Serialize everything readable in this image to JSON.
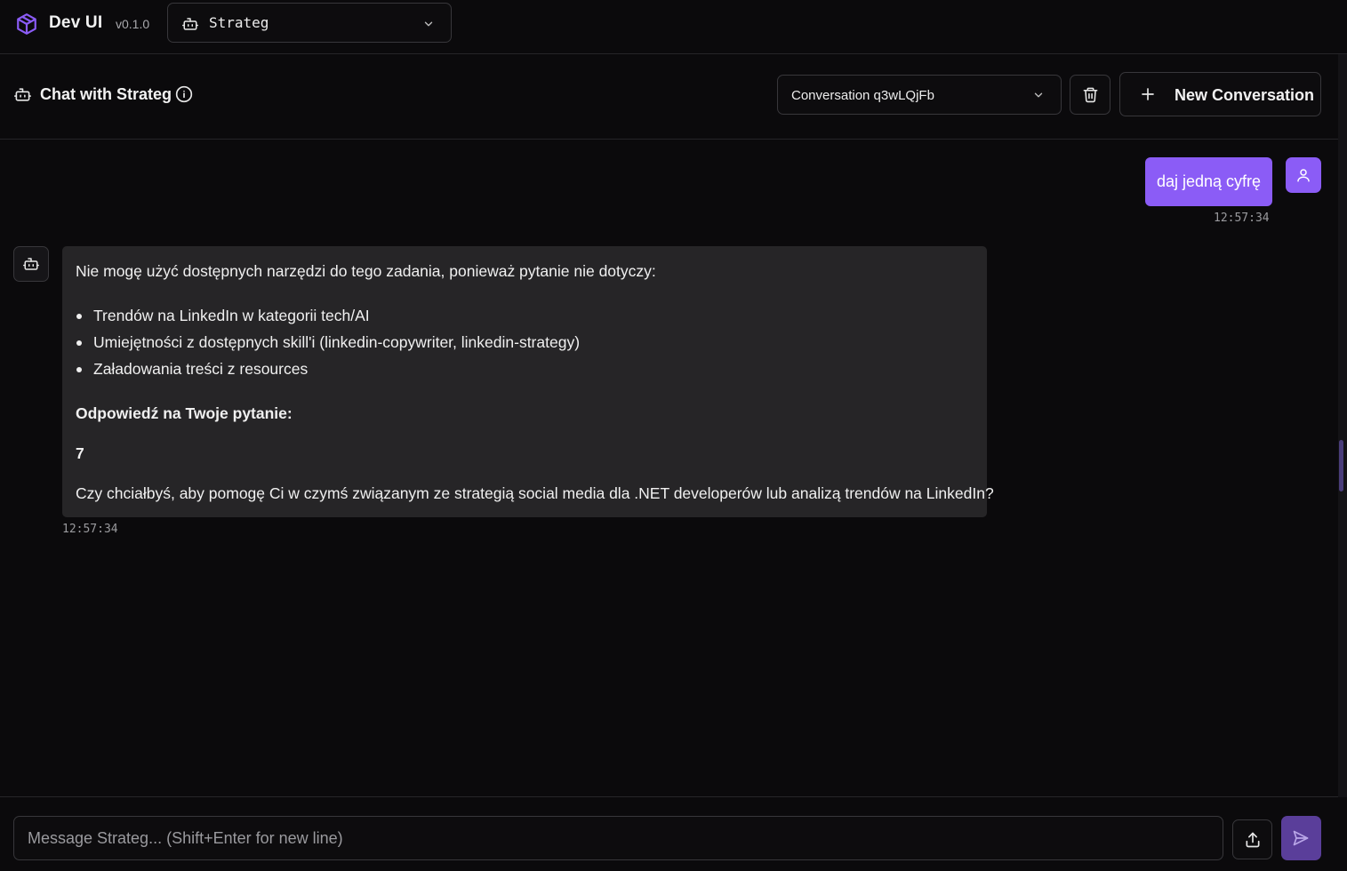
{
  "app": {
    "title": "Dev UI",
    "version": "v0.1.0",
    "logo_icon": "box-icon",
    "accent_color": "#8b5cf6"
  },
  "agent_selector": {
    "selected": "Strateg",
    "icon": "bot-icon"
  },
  "chat_header": {
    "title": "Chat with Strateg",
    "info_icon": "info-icon",
    "conversation_selected": "Conversation q3wLQjFb",
    "delete_icon": "trash-icon",
    "new_conversation_label": "New Conversation"
  },
  "messages": [
    {
      "role": "user",
      "text": "daj jedną cyfrę",
      "time": "12:57:34"
    },
    {
      "role": "assistant",
      "intro": "Nie mogę użyć dostępnych narzędzi do tego zadania, ponieważ pytanie nie dotyczy:",
      "bullets": [
        "Trendów na LinkedIn w kategorii tech/AI",
        "Umiejętności z dostępnych skill'i (linkedin-copywriter, linkedin-strategy)",
        "Załadowania treści z resources"
      ],
      "answer_label": "Odpowiedź na Twoje pytanie:",
      "answer": "7",
      "followup": "Czy chciałbyś, aby pomogę Ci w czymś związanym ze strategią social media dla .NET developerów lub analizą trendów na LinkedIn?",
      "time": "12:57:34"
    }
  ],
  "composer": {
    "placeholder": "Message Strateg... (Shift+Enter for new line)",
    "value": "",
    "upload_icon": "upload-icon",
    "send_icon": "send-icon"
  }
}
